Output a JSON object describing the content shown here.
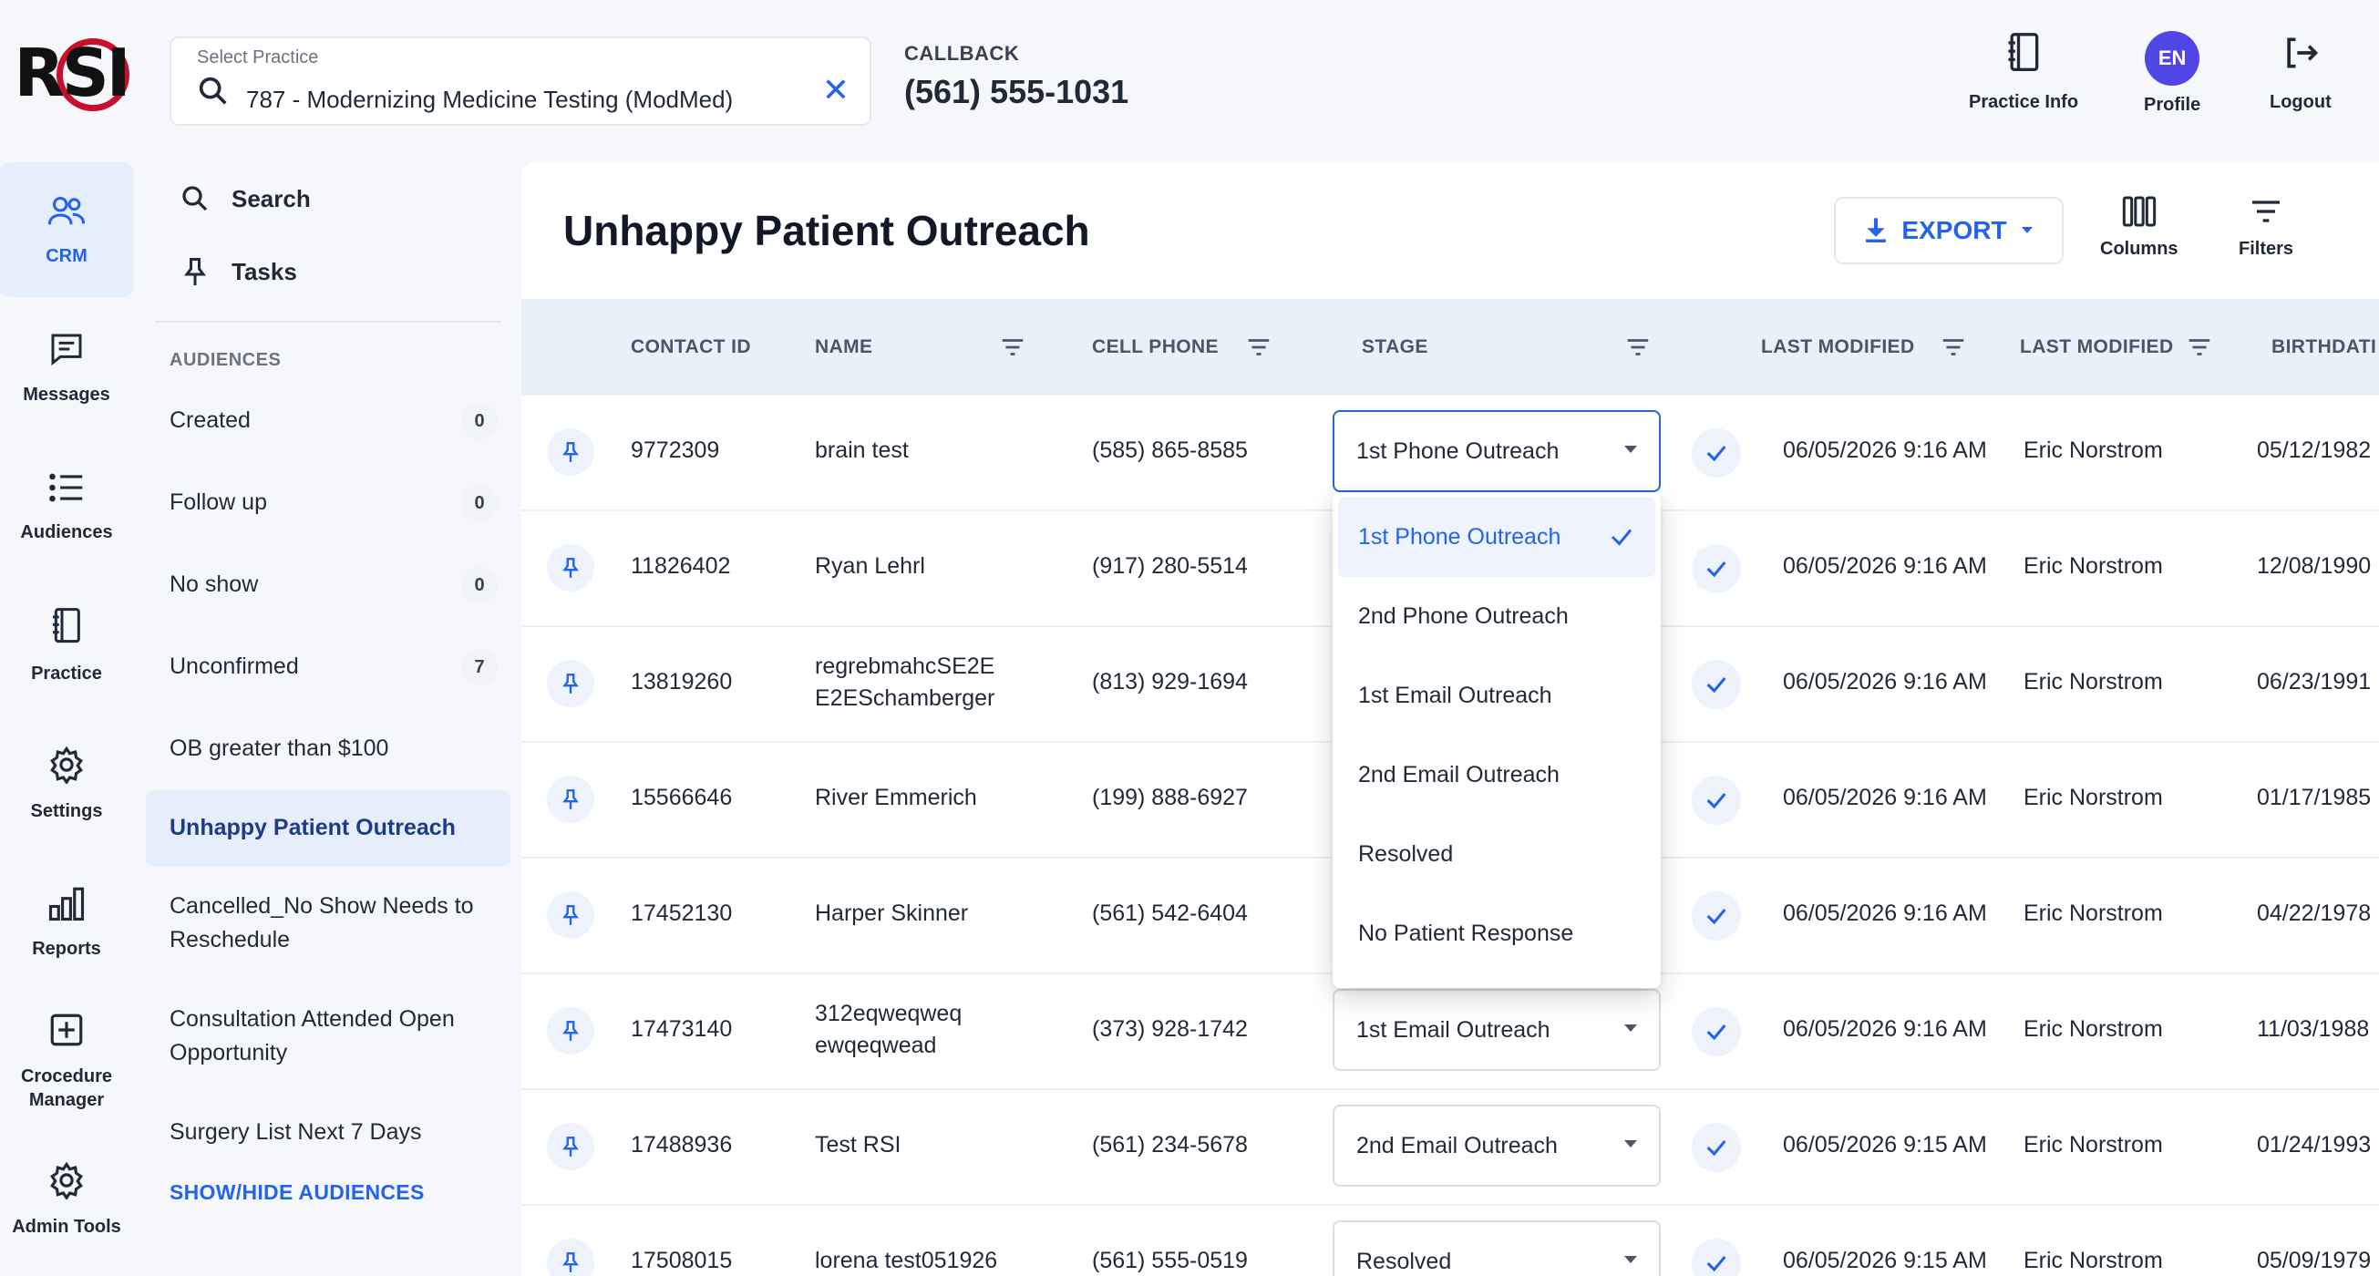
{
  "logo": {
    "text": "RSI"
  },
  "practice": {
    "label": "Select Practice",
    "value": "787 - Modernizing Medicine Testing (ModMed)",
    "clear_icon": "close-icon"
  },
  "callback": {
    "label": "CALLBACK",
    "number": "(561) 555-1031"
  },
  "top_actions": {
    "practice_info": "Practice Info",
    "profile": "Profile",
    "profile_initials": "EN",
    "logout": "Logout"
  },
  "rail": [
    {
      "label": "CRM",
      "icon": "users-icon",
      "active": true
    },
    {
      "label": "Messages",
      "icon": "message-icon"
    },
    {
      "label": "Audiences",
      "icon": "list-icon"
    },
    {
      "label": "Practice",
      "icon": "notebook-icon"
    },
    {
      "label": "Settings",
      "icon": "gear-icon"
    },
    {
      "label": "Reports",
      "icon": "bar-chart-icon"
    },
    {
      "label": "Crocedure Manager",
      "icon": "plus-square-icon"
    },
    {
      "label": "Admin Tools",
      "icon": "gear-icon"
    }
  ],
  "audience_panel": {
    "search_label": "Search",
    "tasks_label": "Tasks",
    "header": "AUDIENCES",
    "items": [
      {
        "label": "Created",
        "count": "0"
      },
      {
        "label": "Follow up",
        "count": "0"
      },
      {
        "label": "No show",
        "count": "0"
      },
      {
        "label": "Unconfirmed",
        "count": "7"
      },
      {
        "label": "OB greater than $100",
        "count": null
      },
      {
        "label": "Unhappy Patient Outreach",
        "count": null,
        "active": true
      },
      {
        "label": "Cancelled_No Show Needs to Reschedule",
        "count": null
      },
      {
        "label": "Consultation Attended Open Opportunity",
        "count": null
      },
      {
        "label": "Surgery List Next 7 Days",
        "count": null
      }
    ],
    "show_hide": "SHOW/HIDE AUDIENCES"
  },
  "main": {
    "title": "Unhappy Patient Outreach",
    "export_label": "EXPORT",
    "columns_label": "Columns",
    "filters_label": "Filters"
  },
  "table": {
    "headers": [
      "CONTACT ID",
      "NAME",
      "CELL PHONE",
      "STAGE",
      "LAST MODIFIED",
      "LAST MODIFIED",
      "BIRTHDATI"
    ],
    "rows": [
      {
        "id": "9772309",
        "name": "brain test",
        "phone": "(585) 865-8585",
        "stage": "1st Phone Outreach",
        "modified": "06/05/2026 9:16 AM",
        "modified_by": "Eric Norstrom",
        "birthdate": "05/12/1982"
      },
      {
        "id": "11826402",
        "name": "Ryan Lehrl",
        "phone": "(917) 280-5514",
        "stage": "",
        "modified": "06/05/2026 9:16 AM",
        "modified_by": "Eric Norstrom",
        "birthdate": "12/08/1990"
      },
      {
        "id": "13819260",
        "name": "regrebmahcSE2E E2ESchamberger",
        "phone": "(813) 929-1694",
        "stage": "",
        "modified": "06/05/2026 9:16 AM",
        "modified_by": "Eric Norstrom",
        "birthdate": "06/23/1991"
      },
      {
        "id": "15566646",
        "name": "River Emmerich",
        "phone": "(199) 888-6927",
        "stage": "",
        "modified": "06/05/2026 9:16 AM",
        "modified_by": "Eric Norstrom",
        "birthdate": "01/17/1985"
      },
      {
        "id": "17452130",
        "name": "Harper Skinner",
        "phone": "(561) 542-6404",
        "stage": "",
        "modified": "06/05/2026 9:16 AM",
        "modified_by": "Eric Norstrom",
        "birthdate": "04/22/1978"
      },
      {
        "id": "17473140",
        "name": "312eqweqweq ewqeqwead",
        "phone": "(373) 928-1742",
        "stage": "1st Email Outreach",
        "modified": "06/05/2026 9:16 AM",
        "modified_by": "Eric Norstrom",
        "birthdate": "11/03/1988"
      },
      {
        "id": "17488936",
        "name": "Test RSI",
        "phone": "(561) 234-5678",
        "stage": "2nd Email Outreach",
        "modified": "06/05/2026 9:15 AM",
        "modified_by": "Eric Norstrom",
        "birthdate": "01/24/1993"
      },
      {
        "id": "17508015",
        "name": "lorena test051926",
        "phone": "(561) 555-0519",
        "stage": "Resolved",
        "modified": "06/05/2026 9:15 AM",
        "modified_by": "Eric Norstrom",
        "birthdate": "05/09/1979"
      }
    ]
  },
  "stage_dropdown": {
    "options": [
      "1st Phone Outreach",
      "2nd Phone Outreach",
      "1st Email Outreach",
      "2nd Email Outreach",
      "Resolved",
      "No Patient Response"
    ],
    "selected": "1st Phone Outreach"
  },
  "colors": {
    "accent": "#2563eb",
    "brand_red": "#c8102e",
    "avatar": "#4f46e5",
    "header_bg": "#eaf0fa"
  }
}
